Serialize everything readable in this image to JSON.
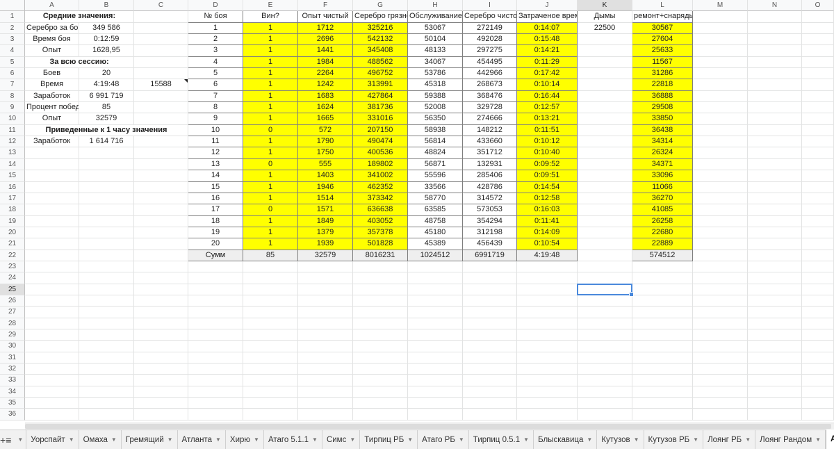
{
  "columns": [
    {
      "label": "A",
      "w": 78
    },
    {
      "label": "B",
      "w": 79
    },
    {
      "label": "C",
      "w": 78
    },
    {
      "label": "D",
      "w": 79
    },
    {
      "label": "E",
      "w": 79
    },
    {
      "label": "F",
      "w": 79
    },
    {
      "label": "G",
      "w": 79
    },
    {
      "label": "H",
      "w": 79
    },
    {
      "label": "I",
      "w": 78
    },
    {
      "label": "J",
      "w": 87
    },
    {
      "label": "K",
      "w": 79
    },
    {
      "label": "L",
      "w": 87
    },
    {
      "label": "M",
      "w": 79
    },
    {
      "label": "N",
      "w": 78
    },
    {
      "label": "O",
      "w": 46
    }
  ],
  "row_count": 36,
  "summary": [
    {
      "row": 1,
      "cells": [
        {
          "col": 0,
          "text": "Средние значения:",
          "bold": true,
          "span": 2
        }
      ]
    },
    {
      "row": 2,
      "cells": [
        {
          "col": 0,
          "text": "Серебро за бой"
        },
        {
          "col": 1,
          "text": "349 586"
        }
      ]
    },
    {
      "row": 3,
      "cells": [
        {
          "col": 0,
          "text": "Время боя"
        },
        {
          "col": 1,
          "text": "0:12:59"
        }
      ]
    },
    {
      "row": 4,
      "cells": [
        {
          "col": 0,
          "text": "Опыт"
        },
        {
          "col": 1,
          "text": "1628,95"
        }
      ]
    },
    {
      "row": 5,
      "cells": [
        {
          "col": 0,
          "text": "За всю сессию:",
          "bold": true,
          "span": 2
        }
      ]
    },
    {
      "row": 6,
      "cells": [
        {
          "col": 0,
          "text": "Боев"
        },
        {
          "col": 1,
          "text": "20"
        }
      ]
    },
    {
      "row": 7,
      "cells": [
        {
          "col": 0,
          "text": "Время"
        },
        {
          "col": 1,
          "text": "4:19:48"
        },
        {
          "col": 2,
          "text": "15588",
          "note": true
        }
      ]
    },
    {
      "row": 8,
      "cells": [
        {
          "col": 0,
          "text": "Заработок"
        },
        {
          "col": 1,
          "text": "6 991 719"
        }
      ]
    },
    {
      "row": 9,
      "cells": [
        {
          "col": 0,
          "text": "Процент побед"
        },
        {
          "col": 1,
          "text": "85"
        }
      ]
    },
    {
      "row": 10,
      "cells": [
        {
          "col": 0,
          "text": "Опыт"
        },
        {
          "col": 1,
          "text": "32579"
        }
      ]
    },
    {
      "row": 11,
      "cells": [
        {
          "col": 0,
          "text": "Приведенные к 1 часу значения",
          "bold": true,
          "span": 3
        }
      ]
    },
    {
      "row": 12,
      "cells": [
        {
          "col": 0,
          "text": "Заработок"
        },
        {
          "col": 1,
          "text": "1 614 716"
        }
      ]
    }
  ],
  "battle_table": {
    "headers": [
      "№ боя",
      "Вин?",
      "Опыт чистый",
      "Серебро грязное",
      "Обслуживание",
      "Серебро чистое",
      "Затраченое время"
    ],
    "rows": [
      [
        "1",
        "1",
        "1712",
        "325216",
        "53067",
        "272149",
        "0:14:07"
      ],
      [
        "2",
        "1",
        "2696",
        "542132",
        "50104",
        "492028",
        "0:15:48"
      ],
      [
        "3",
        "1",
        "1441",
        "345408",
        "48133",
        "297275",
        "0:14:21"
      ],
      [
        "4",
        "1",
        "1984",
        "488562",
        "34067",
        "454495",
        "0:11:29"
      ],
      [
        "5",
        "1",
        "2264",
        "496752",
        "53786",
        "442966",
        "0:17:42"
      ],
      [
        "6",
        "1",
        "1242",
        "313991",
        "45318",
        "268673",
        "0:10:14"
      ],
      [
        "7",
        "1",
        "1683",
        "427864",
        "59388",
        "368476",
        "0:16:44"
      ],
      [
        "8",
        "1",
        "1624",
        "381736",
        "52008",
        "329728",
        "0:12:57"
      ],
      [
        "9",
        "1",
        "1665",
        "331016",
        "56350",
        "274666",
        "0:13:21"
      ],
      [
        "10",
        "0",
        "572",
        "207150",
        "58938",
        "148212",
        "0:11:51"
      ],
      [
        "11",
        "1",
        "1790",
        "490474",
        "56814",
        "433660",
        "0:10:12"
      ],
      [
        "12",
        "1",
        "1750",
        "400536",
        "48824",
        "351712",
        "0:10:40"
      ],
      [
        "13",
        "0",
        "555",
        "189802",
        "56871",
        "132931",
        "0:09:52"
      ],
      [
        "14",
        "1",
        "1403",
        "341002",
        "55596",
        "285406",
        "0:09:51"
      ],
      [
        "15",
        "1",
        "1946",
        "462352",
        "33566",
        "428786",
        "0:14:54"
      ],
      [
        "16",
        "1",
        "1514",
        "373342",
        "58770",
        "314572",
        "0:12:58"
      ],
      [
        "17",
        "0",
        "1571",
        "636638",
        "63585",
        "573053",
        "0:16:03"
      ],
      [
        "18",
        "1",
        "1849",
        "403052",
        "48758",
        "354294",
        "0:11:41"
      ],
      [
        "19",
        "1",
        "1379",
        "357378",
        "45180",
        "312198",
        "0:14:09"
      ],
      [
        "20",
        "1",
        "1939",
        "501828",
        "45389",
        "456439",
        "0:10:54"
      ]
    ],
    "totals": [
      "Сумм",
      "85",
      "32579",
      "8016231",
      "1024512",
      "6991719",
      "4:19:48"
    ]
  },
  "smoke": {
    "header": "Дымы",
    "value": "22500"
  },
  "repairs": {
    "header": "ремонт+снаряды",
    "values": [
      "30567",
      "27604",
      "25633",
      "11567",
      "31286",
      "22818",
      "36888",
      "29508",
      "33850",
      "36438",
      "34314",
      "26324",
      "34371",
      "33096",
      "11066",
      "36270",
      "41085",
      "26258",
      "22680",
      "22889"
    ],
    "total": "574512"
  },
  "colors": {
    "highlight": "#ffff00",
    "selection": "#4a89dc",
    "total_row": "#efefef"
  },
  "selection": {
    "row": 25,
    "col": "K"
  },
  "sheet_tabs": [
    {
      "label": "Уорспайт"
    },
    {
      "label": "Омаха"
    },
    {
      "label": "Гремящий"
    },
    {
      "label": "Атланта"
    },
    {
      "label": "Хирю"
    },
    {
      "label": "Атаго 5.1.1"
    },
    {
      "label": "Симс"
    },
    {
      "label": "Тирпиц РБ"
    },
    {
      "label": "Атаго РБ"
    },
    {
      "label": "Тирпиц 0.5.1"
    },
    {
      "label": "Блыскавица"
    },
    {
      "label": "Кутузов"
    },
    {
      "label": "Кутузов РБ"
    },
    {
      "label": "Лоянг РБ"
    },
    {
      "label": "Лоянг Рандом"
    },
    {
      "label": "Аншан",
      "active": true
    }
  ],
  "icons": {
    "add_sheet": "plus-icon",
    "all_sheets": "menu-icon"
  }
}
